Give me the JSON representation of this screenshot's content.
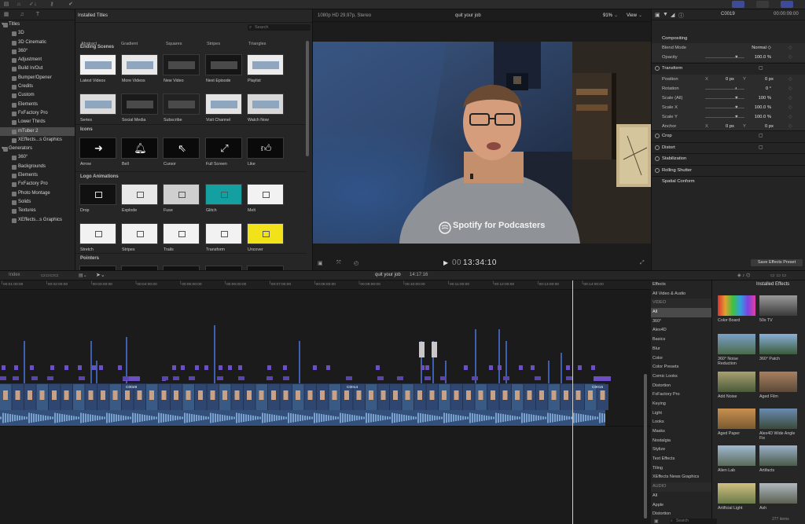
{
  "toolbar": {
    "icons": [
      "import-icon",
      "keyword-icon",
      "check-icon",
      "download-icon",
      "key-icon",
      "done-icon"
    ]
  },
  "library": {
    "items": [
      {
        "label": "Titles",
        "level": 0,
        "expanded": true
      },
      {
        "label": "3D",
        "level": 1
      },
      {
        "label": "3D Cinematic",
        "level": 1
      },
      {
        "label": "360°",
        "level": 1
      },
      {
        "label": "Adjustment",
        "level": 1
      },
      {
        "label": "Build In/Out",
        "level": 1
      },
      {
        "label": "Bumper/Opener",
        "level": 1
      },
      {
        "label": "Credits",
        "level": 1
      },
      {
        "label": "Custom",
        "level": 1
      },
      {
        "label": "Elements",
        "level": 1
      },
      {
        "label": "FxFactory Pro",
        "level": 1
      },
      {
        "label": "Lower Thirds",
        "level": 1
      },
      {
        "label": "mTuber 2",
        "level": 1,
        "selected": true
      },
      {
        "label": "XEffects...s Graphics",
        "level": 1
      },
      {
        "label": "Generators",
        "level": 0,
        "expanded": true
      },
      {
        "label": "360°",
        "level": 1
      },
      {
        "label": "Backgrounds",
        "level": 1
      },
      {
        "label": "Elements",
        "level": 1
      },
      {
        "label": "FxFactory Pro",
        "level": 1
      },
      {
        "label": "Photo Montage",
        "level": 1
      },
      {
        "label": "Solids",
        "level": 1
      },
      {
        "label": "Textures",
        "level": 1
      },
      {
        "label": "XEffects...s Graphics",
        "level": 1
      }
    ]
  },
  "browser": {
    "title": "Installed Titles",
    "search_placeholder": "Search",
    "top_row": [
      "Abstract",
      "Gradient",
      "Squares",
      "Stripes",
      "Triangles"
    ],
    "sections": [
      {
        "title": "Ending Scenes",
        "items": [
          "Latest Videos",
          "More Videos",
          "New Video",
          "Next Episode",
          "Playlist",
          "Series",
          "Social Media",
          "Subscribe",
          "Visit Channel",
          "Watch Now"
        ]
      },
      {
        "title": "Icons",
        "items": [
          "Arrow",
          "Bell",
          "Cursor",
          "Full Screen",
          "Like"
        ]
      },
      {
        "title": "Logo Animations",
        "items": [
          "Drop",
          "Explode",
          "Fuse",
          "Glitch",
          "Melt",
          "Stretch",
          "Stripes",
          "Trails",
          "Transform",
          "Uncover"
        ]
      },
      {
        "title": "Pointers",
        "items": []
      }
    ]
  },
  "viewer": {
    "format": "1080p HD 29.97p, Stereo",
    "clip_title": "quit your job",
    "zoom": "91%",
    "view_label": "View",
    "timecode": "13:34:10",
    "shirt_text": "Spotify for Podcasters"
  },
  "inspector": {
    "clip_name": "C0019",
    "duration": "00:00:09:00",
    "rows": [
      {
        "label": "Compositing",
        "type": "header"
      },
      {
        "label": "Blend Mode",
        "value": "Normal ◇",
        "type": "param"
      },
      {
        "label": "Opacity",
        "value": "100.0 %",
        "type": "param"
      },
      {
        "label": "Transform",
        "type": "section"
      },
      {
        "label": "Position",
        "x": "0 px",
        "y": "0 px",
        "type": "xy"
      },
      {
        "label": "Rotation",
        "value": "0 °",
        "type": "param"
      },
      {
        "label": "Scale (All)",
        "value": "100 %",
        "type": "param"
      },
      {
        "label": "Scale X",
        "value": "100.0 %",
        "type": "param"
      },
      {
        "label": "Scale Y",
        "value": "100.0 %",
        "type": "param"
      },
      {
        "label": "Anchor",
        "x": "0 px",
        "y": "0 px",
        "type": "xy"
      },
      {
        "label": "Crop",
        "type": "section"
      },
      {
        "label": "Distort",
        "type": "section"
      },
      {
        "label": "Stabilization",
        "type": "section"
      },
      {
        "label": "Rolling Shutter",
        "type": "section"
      },
      {
        "label": "Spatial Conform",
        "type": "plain"
      }
    ],
    "save_preset": "Save Effects Preset",
    "x_label": "X",
    "y_label": "Y"
  },
  "timeline": {
    "index_label": "Index",
    "project_title": "quit your job",
    "project_duration": "14:17:16",
    "ruler": [
      "00:01:00:00",
      "00:02:00:00",
      "00:03:00:00",
      "00:04:00:00",
      "00:05:00:00",
      "00:06:00:00",
      "00:07:00:00",
      "00:08:00:00",
      "00:09:00:00",
      "00:10:00:00",
      "00:11:00:00",
      "00:12:00:00",
      "00:13:00:00",
      "00:14:00:00"
    ],
    "clip_labels": [
      "C0028",
      "C0014",
      "C0015"
    ]
  },
  "effects": {
    "header": "Effects",
    "title": "Installed Effects",
    "categories": [
      {
        "label": "All Video & Audio"
      },
      {
        "label": "VIDEO",
        "group": true
      },
      {
        "label": "All",
        "selected": true
      },
      {
        "label": "360°"
      },
      {
        "label": "Alex4D"
      },
      {
        "label": "Basics"
      },
      {
        "label": "Blur"
      },
      {
        "label": "Color"
      },
      {
        "label": "Color Presets"
      },
      {
        "label": "Comic Looks"
      },
      {
        "label": "Distortion"
      },
      {
        "label": "FxFactory Pro"
      },
      {
        "label": "Keying"
      },
      {
        "label": "Light"
      },
      {
        "label": "Looks"
      },
      {
        "label": "Masks"
      },
      {
        "label": "Nostalgia"
      },
      {
        "label": "Stylize"
      },
      {
        "label": "Text Effects"
      },
      {
        "label": "Tiling"
      },
      {
        "label": "XEffects News Graphics"
      },
      {
        "label": "AUDIO",
        "group": true
      },
      {
        "label": "All"
      },
      {
        "label": "Apple"
      },
      {
        "label": "Distortion"
      }
    ],
    "items": [
      "Color Board",
      "50s TV",
      "360° Noise Reduction",
      "360° Patch",
      "Add Noise",
      "Aged Film",
      "Aged Paper",
      "Alex4D Wide Angle Fix",
      "Alien Lab",
      "Artifacts",
      "Artificial Light",
      "Ash"
    ],
    "count": "277 items",
    "search_placeholder": "Search"
  }
}
